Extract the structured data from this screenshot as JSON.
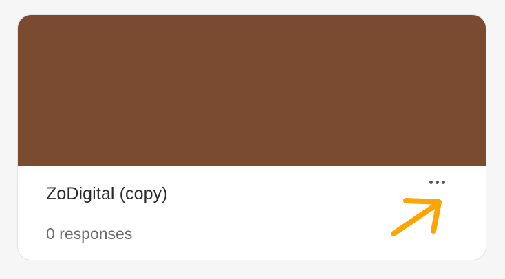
{
  "form_card": {
    "cover_color": "#7a4a31",
    "title": "ZoDigital (copy)",
    "responses": "0 responses",
    "more_icon": "more-horizontal-icon"
  },
  "annotation": {
    "icon": "arrow-icon",
    "color": "#ffa500"
  }
}
